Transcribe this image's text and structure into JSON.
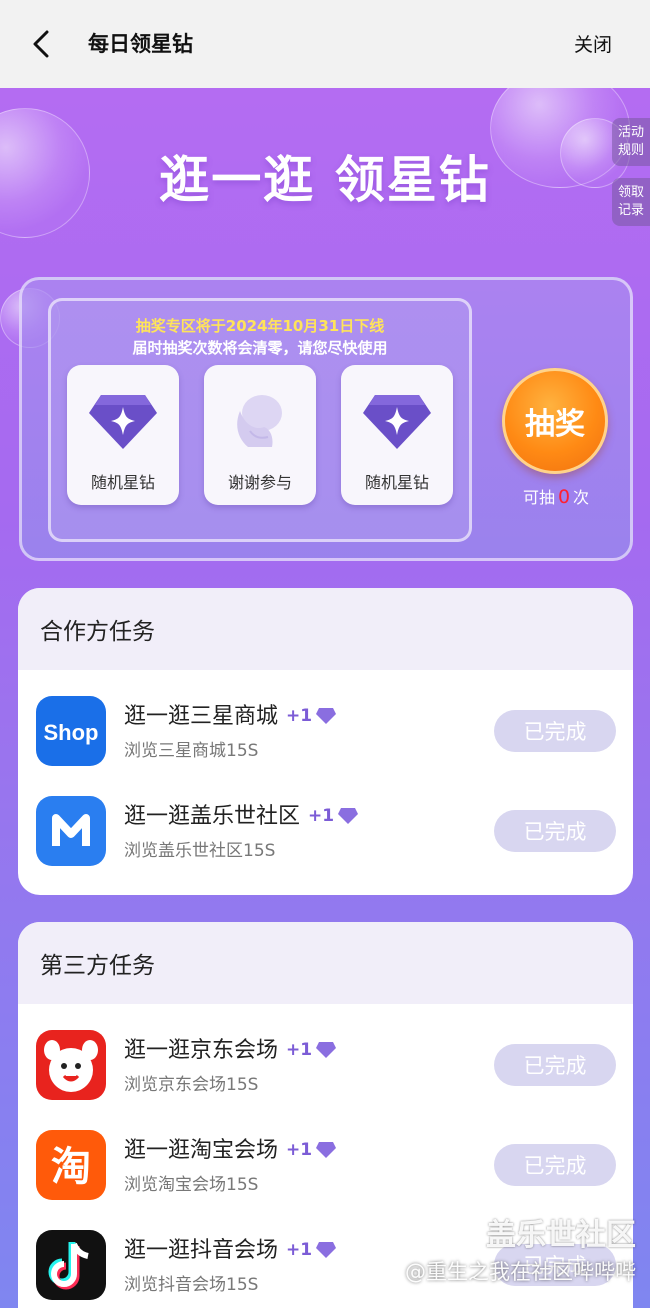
{
  "header": {
    "title": "每日领星钻",
    "close_label": "关闭"
  },
  "hero": {
    "title": "逛一逛 领星钻"
  },
  "side_tabs": {
    "rules": "活动\n规则",
    "records": "领取\n记录"
  },
  "lottery": {
    "notice_line1": "抽奖专区将于2024年10月31日下线",
    "notice_line2": "届时抽奖次数将会清零，请您尽快使用",
    "prizes": [
      {
        "label": "随机星钻",
        "icon": "diamond-icon"
      },
      {
        "label": "谢谢参与",
        "icon": "thanks-icon"
      },
      {
        "label": "随机星钻",
        "icon": "diamond-icon"
      }
    ],
    "draw_label": "抽奖",
    "count_prefix": "可抽",
    "count_value": "0",
    "count_suffix": "次"
  },
  "partner_tasks": {
    "heading": "合作方任务",
    "items": [
      {
        "title": "逛一逛三星商城",
        "reward": "+1",
        "subtitle": "浏览三星商城15S",
        "button": "已完成",
        "icon": "samsung-shop-icon"
      },
      {
        "title": "逛一逛盖乐世社区",
        "reward": "+1",
        "subtitle": "浏览盖乐世社区15S",
        "button": "已完成",
        "icon": "members-icon"
      }
    ]
  },
  "third_party_tasks": {
    "heading": "第三方任务",
    "items": [
      {
        "title": "逛一逛京东会场",
        "reward": "+1",
        "subtitle": "浏览京东会场15S",
        "button": "已完成",
        "icon": "jd-icon"
      },
      {
        "title": "逛一逛淘宝会场",
        "reward": "+1",
        "subtitle": "浏览淘宝会场15S",
        "button": "已完成",
        "icon": "taobao-icon"
      },
      {
        "title": "逛一逛抖音会场",
        "reward": "+1",
        "subtitle": "浏览抖音会场15S",
        "button": "已完成",
        "icon": "douyin-icon"
      }
    ]
  },
  "watermark": {
    "line1": "盖乐世社区",
    "line2": "@重生之我在社区哔哔哔"
  },
  "colors": {
    "accent": "#7c5cd6",
    "draw_button": "#ff8a14",
    "count_highlight": "#ff2030",
    "done_button": "#d8d6f0"
  }
}
